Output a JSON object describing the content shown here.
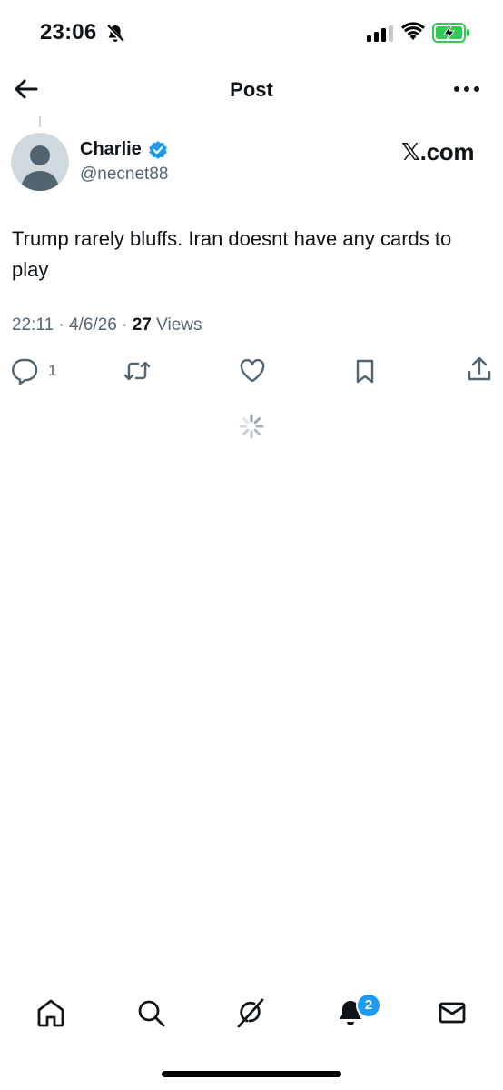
{
  "status_bar": {
    "time": "23:06",
    "battery_color": "#34c759"
  },
  "header": {
    "title": "Post"
  },
  "post": {
    "author_name": "Charlie",
    "author_handle": "@necnet88",
    "site_label": "𝕏.com",
    "text": "Trump rarely bluffs. Iran doesnt have any cards to play",
    "timestamp": "22:11 · 4/6/26 · ",
    "views_count": "27",
    "views_label": " Views",
    "reply_count": "1",
    "verified_color": "#1d9bf0"
  },
  "tab_bar": {
    "tabs": [
      "home-icon",
      "search-icon",
      "grok-icon",
      "notifications-icon",
      "messages-icon"
    ],
    "notification_badge": "2"
  }
}
